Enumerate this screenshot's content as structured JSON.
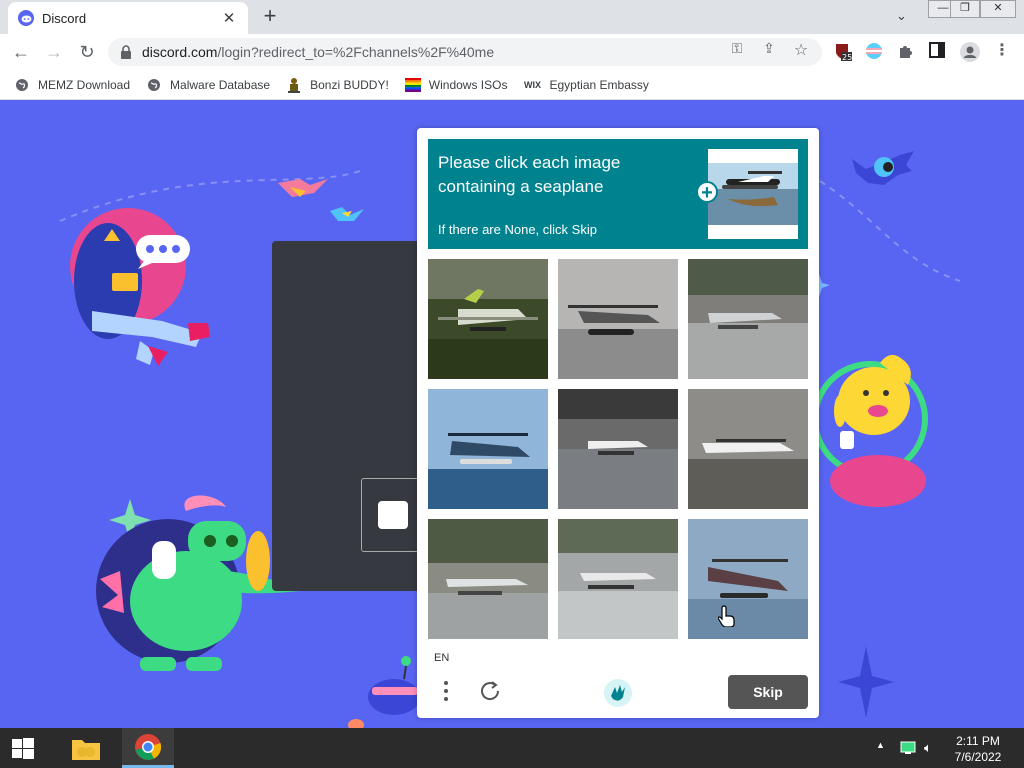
{
  "browser": {
    "tab_title": "Discord",
    "url_host": "discord.com",
    "url_path": "/login?redirect_to=%2Fchannels%2F%40me",
    "extension_badge": "25",
    "bookmarks": [
      {
        "label": "MEMZ Download",
        "icon": "globe-icon"
      },
      {
        "label": "Malware Database",
        "icon": "globe-icon"
      },
      {
        "label": "Bonzi BUDDY!",
        "icon": "bonzi-icon"
      },
      {
        "label": "Windows ISOs",
        "icon": "rainbow-flag-icon"
      },
      {
        "label": "Egyptian Embassy",
        "icon": "wix-icon",
        "icon_text": "WIX"
      }
    ]
  },
  "captcha": {
    "prompt": "Please click each image containing a seaplane",
    "sub_prompt": "If there are None, click Skip",
    "language": "EN",
    "skip_label": "Skip",
    "accent_color": "#00838f"
  },
  "taskbar": {
    "time": "2:11 PM",
    "date": "7/6/2022"
  },
  "colors": {
    "discord_blurple": "#5865f2",
    "dark_panel": "#36393f",
    "taskbar": "#2b2b2b"
  }
}
